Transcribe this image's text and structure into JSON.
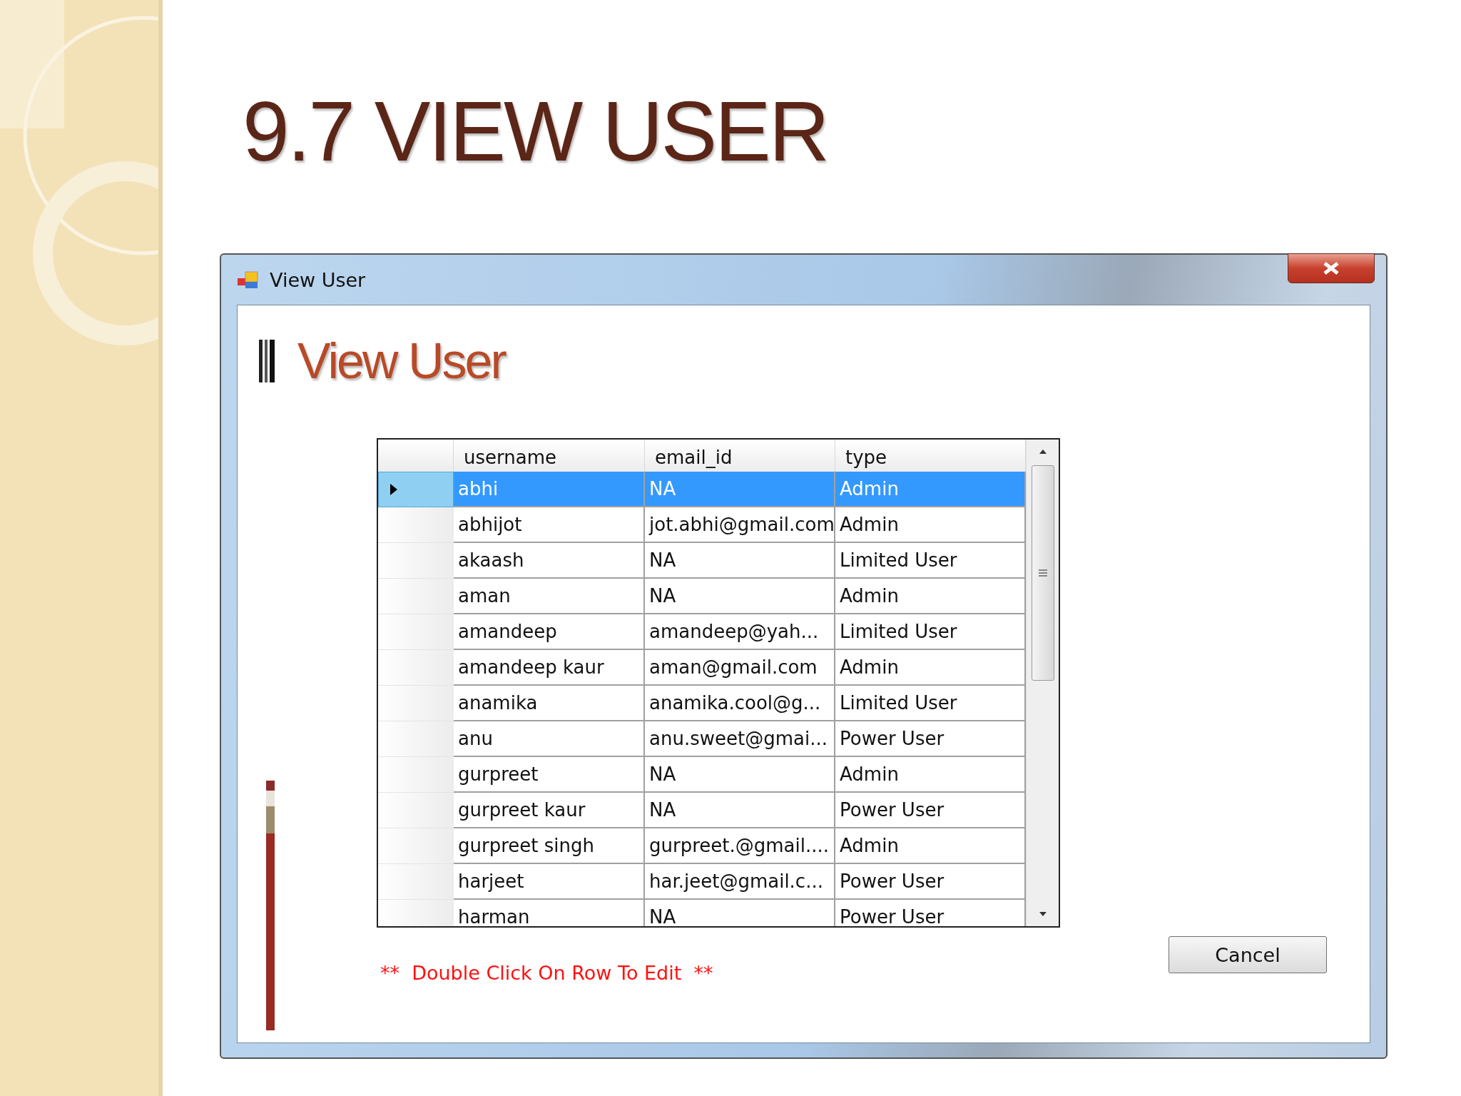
{
  "slide_title": "9.7 VIEW USER",
  "window": {
    "title": "View User"
  },
  "heading": "View User",
  "table": {
    "columns": [
      "username",
      "email_id",
      "type"
    ],
    "rows": [
      {
        "cells": [
          "abhi",
          "NA",
          "Admin"
        ],
        "selected": true
      },
      {
        "cells": [
          "abhijot",
          "jot.abhi@gmail.com",
          "Admin"
        ],
        "selected": false
      },
      {
        "cells": [
          "akaash",
          "NA",
          "Limited User"
        ],
        "selected": false
      },
      {
        "cells": [
          "aman",
          "NA",
          "Admin"
        ],
        "selected": false
      },
      {
        "cells": [
          "amandeep",
          "amandeep@yah...",
          "Limited User"
        ],
        "selected": false
      },
      {
        "cells": [
          "amandeep kaur",
          "aman@gmail.com",
          "Admin"
        ],
        "selected": false
      },
      {
        "cells": [
          "anamika",
          "anamika.cool@g...",
          "Limited User"
        ],
        "selected": false
      },
      {
        "cells": [
          "anu",
          "anu.sweet@gmai...",
          "Power User"
        ],
        "selected": false
      },
      {
        "cells": [
          "gurpreet",
          "NA",
          "Admin"
        ],
        "selected": false
      },
      {
        "cells": [
          "gurpreet kaur",
          "NA",
          "Power User"
        ],
        "selected": false
      },
      {
        "cells": [
          "gurpreet singh",
          "gurpreet.@gmail....",
          "Admin"
        ],
        "selected": false
      },
      {
        "cells": [
          "harjeet",
          "har.jeet@gmail.c...",
          "Power User"
        ],
        "selected": false
      },
      {
        "cells": [
          "harman",
          "NA",
          "Power User"
        ],
        "selected": false
      }
    ]
  },
  "note": "**  Double Click On Row To Edit  **",
  "buttons": [
    "Cancel"
  ]
}
